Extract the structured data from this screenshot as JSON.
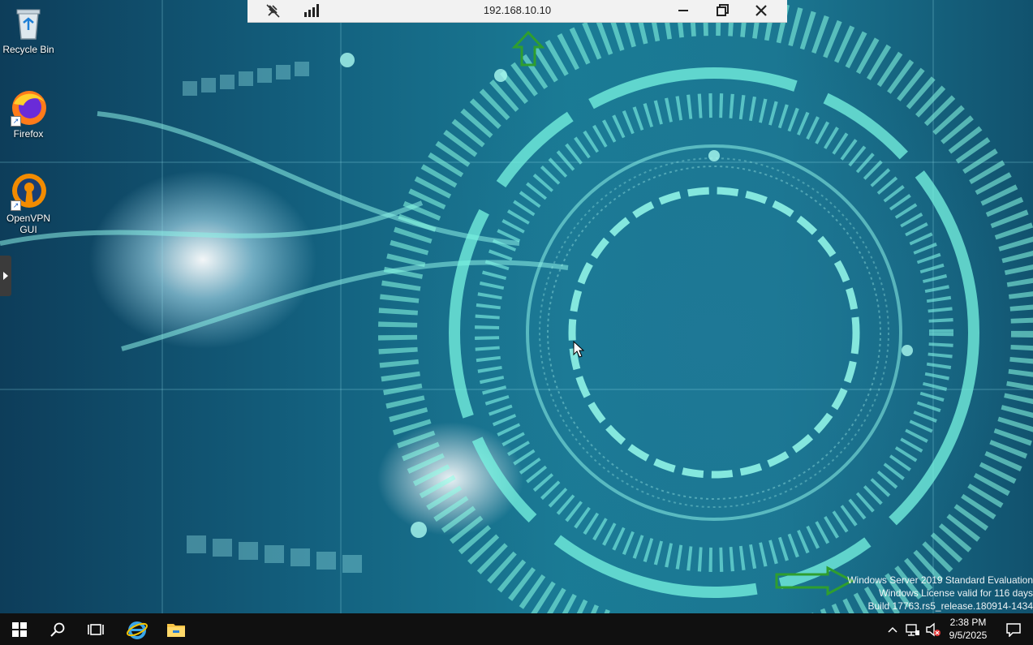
{
  "desktop": {
    "icons": [
      {
        "label": "Recycle Bin",
        "icon": "recycle-bin-icon"
      },
      {
        "label": "Firefox",
        "icon": "firefox-icon"
      },
      {
        "label": "OpenVPN GUI",
        "icon": "openvpn-icon"
      }
    ],
    "shortcut_arrow": "↗"
  },
  "rdp_bar": {
    "host": "192.168.10.10",
    "icons": [
      "pin-icon",
      "signal-bars-icon",
      "minimize-icon",
      "restore-icon",
      "close-icon"
    ]
  },
  "watermark": {
    "line1": "Windows Server 2019 Standard Evaluation",
    "line2": "Windows License valid for 116 days",
    "line3": "Build 17763.rs5_release.180914-1434"
  },
  "taskbar": {
    "items": [
      "start-icon",
      "search-icon",
      "task-view-icon",
      "internet-explorer-icon",
      "file-explorer-icon"
    ],
    "tray": [
      "chevron-up-icon",
      "network-icon",
      "volume-muted-icon",
      "action-center-icon"
    ],
    "clock": {
      "time": "2:38 PM",
      "date": "9/5/2025"
    }
  },
  "colors": {
    "accent_green": "#2f9e2f",
    "taskbar": "#101010",
    "rdp_bar": "#f2f2f2"
  }
}
